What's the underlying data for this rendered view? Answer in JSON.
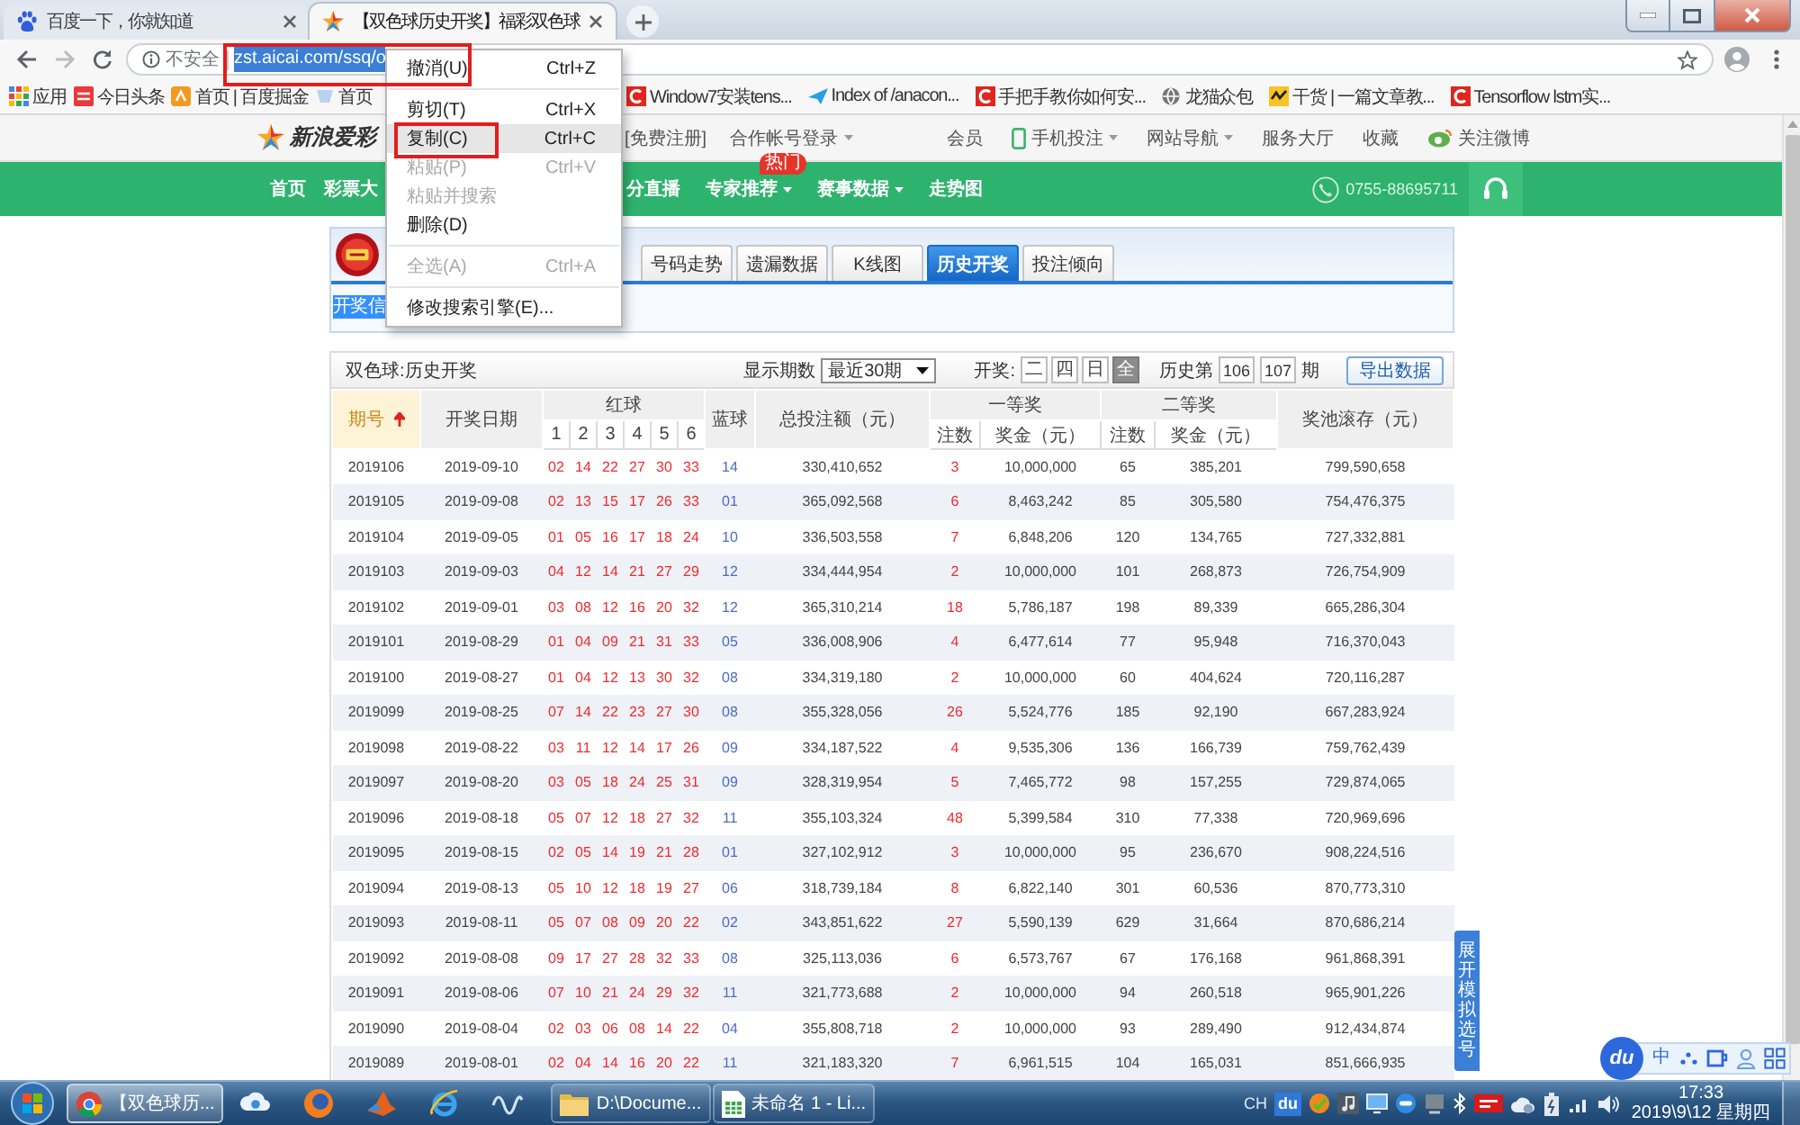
{
  "browser": {
    "tabs": [
      {
        "title": "百度一下，你就知道",
        "selected": false
      },
      {
        "title": "【双色球历史开奖】福彩双色球",
        "selected": true
      }
    ],
    "address": {
      "security": "不安全",
      "url": "zst.aicai.com/ssq/o",
      "highlighted": true
    },
    "bookmarks": [
      {
        "label": "应用"
      },
      {
        "label": "今日头条"
      },
      {
        "label": "首页 | 百度掘金"
      },
      {
        "label": "首页"
      },
      {
        "label": "Window7安装tens..."
      },
      {
        "label": "Index of /anacon..."
      },
      {
        "label": "手把手教你如何安..."
      },
      {
        "label": "龙猫众包"
      },
      {
        "label": "干货 | 一篇文章教..."
      },
      {
        "label": "Tensorflow lstm实..."
      }
    ]
  },
  "context_menu": {
    "items": [
      {
        "kind": "item",
        "label": "撤消(U)",
        "shortcut": "Ctrl+Z",
        "disabled": false,
        "selected": false
      },
      {
        "kind": "separator"
      },
      {
        "kind": "item",
        "label": "剪切(T)",
        "shortcut": "Ctrl+X",
        "disabled": false,
        "selected": false
      },
      {
        "kind": "item",
        "label": "复制(C)",
        "shortcut": "Ctrl+C",
        "disabled": false,
        "selected": true
      },
      {
        "kind": "item",
        "label": "粘贴(P)",
        "shortcut": "Ctrl+V",
        "disabled": true,
        "selected": false
      },
      {
        "kind": "item",
        "label": "粘贴并搜索",
        "disabled": true,
        "selected": false
      },
      {
        "kind": "item",
        "label": "删除(D)",
        "disabled": false,
        "selected": false
      },
      {
        "kind": "separator"
      },
      {
        "kind": "item",
        "label": "全选(A)",
        "shortcut": "Ctrl+A",
        "disabled": true,
        "selected": false
      },
      {
        "kind": "separator"
      },
      {
        "kind": "item",
        "label": "修改搜索引擎(E)...",
        "disabled": false,
        "selected": false
      }
    ]
  },
  "site_header": {
    "logo": "新浪爱彩",
    "account_links": [
      {
        "label": "[免费注册]",
        "dropdown": false
      },
      {
        "label": "合作帐号登录",
        "dropdown": true
      }
    ],
    "links": [
      {
        "label": "会员",
        "dropdown": false
      },
      {
        "label": "手机投注",
        "dropdown": true
      },
      {
        "label": "网站导航",
        "dropdown": true
      },
      {
        "label": "服务大厅",
        "dropdown": false
      },
      {
        "label": "收藏",
        "dropdown": false
      },
      {
        "label": "关注微博",
        "dropdown": false
      }
    ]
  },
  "nav": {
    "items": [
      {
        "label": "首页",
        "dropdown": false
      },
      {
        "label": "彩票大",
        "dropdown": false
      },
      {
        "label": "分直播",
        "dropdown": false
      },
      {
        "label": "专家推荐",
        "dropdown": true,
        "badge": "热门"
      },
      {
        "label": "赛事数据",
        "dropdown": true
      },
      {
        "label": "走势图",
        "dropdown": false
      }
    ],
    "hotline": "0755-88695711"
  },
  "lottery_panel": {
    "tabs": [
      {
        "label": "号码走势",
        "selected": false
      },
      {
        "label": "遗漏数据",
        "selected": false
      },
      {
        "label": "K线图",
        "selected": false
      },
      {
        "label": "历史开奖",
        "selected": true
      },
      {
        "label": "投注倾向",
        "selected": false
      }
    ],
    "info": {
      "text": "开奖信",
      "highlighted": true
    }
  },
  "results": {
    "title": "双色球:历史开奖",
    "period_label": "显示期数",
    "period_select": "最近30期",
    "draw_label": "开奖:",
    "draw_days": [
      {
        "label": "二",
        "selected": false
      },
      {
        "label": "四",
        "selected": false
      },
      {
        "label": "日",
        "selected": false
      },
      {
        "label": "全",
        "selected": true
      }
    ],
    "history_label": "历史第",
    "history_from": "106",
    "history_to": "107",
    "history_unit": "期",
    "export": "导出数据",
    "columns": [
      {
        "label": "期号",
        "sorted": true
      },
      {
        "label": "开奖日期",
        "sorted": false
      },
      {
        "label": "红球",
        "sorted": false,
        "sub": [
          "1",
          "2",
          "3",
          "4",
          "5",
          "6"
        ]
      },
      {
        "label": "蓝球",
        "sorted": false
      },
      {
        "label": "总投注额（元）",
        "sorted": false
      },
      {
        "label": "一等奖",
        "sorted": false,
        "sub": [
          "注数",
          "奖金（元）"
        ]
      },
      {
        "label": "二等奖",
        "sorted": false,
        "sub": [
          "注数",
          "奖金（元）"
        ]
      },
      {
        "label": "奖池滚存（元）",
        "sorted": false
      }
    ],
    "rows": [
      {
        "issue": "2019106",
        "date": "2019-09-10",
        "red": [
          "02",
          "14",
          "22",
          "27",
          "30",
          "33"
        ],
        "blue": "14",
        "sales": "330,410,652",
        "first_count": "3",
        "first_prize": "10,000,000",
        "second_count": "65",
        "second_prize": "385,201",
        "pool": "799,590,658"
      },
      {
        "issue": "2019105",
        "date": "2019-09-08",
        "red": [
          "02",
          "13",
          "15",
          "17",
          "26",
          "33"
        ],
        "blue": "01",
        "sales": "365,092,568",
        "first_count": "6",
        "first_prize": "8,463,242",
        "second_count": "85",
        "second_prize": "305,580",
        "pool": "754,476,375"
      },
      {
        "issue": "2019104",
        "date": "2019-09-05",
        "red": [
          "01",
          "05",
          "16",
          "17",
          "18",
          "24"
        ],
        "blue": "10",
        "sales": "336,503,558",
        "first_count": "7",
        "first_prize": "6,848,206",
        "second_count": "120",
        "second_prize": "134,765",
        "pool": "727,332,881"
      },
      {
        "issue": "2019103",
        "date": "2019-09-03",
        "red": [
          "04",
          "12",
          "14",
          "21",
          "27",
          "29"
        ],
        "blue": "12",
        "sales": "334,444,954",
        "first_count": "2",
        "first_prize": "10,000,000",
        "second_count": "101",
        "second_prize": "268,873",
        "pool": "726,754,909"
      },
      {
        "issue": "2019102",
        "date": "2019-09-01",
        "red": [
          "03",
          "08",
          "12",
          "16",
          "20",
          "32"
        ],
        "blue": "12",
        "sales": "365,310,214",
        "first_count": "18",
        "first_prize": "5,786,187",
        "second_count": "198",
        "second_prize": "89,339",
        "pool": "665,286,304"
      },
      {
        "issue": "2019101",
        "date": "2019-08-29",
        "red": [
          "01",
          "04",
          "09",
          "21",
          "31",
          "33"
        ],
        "blue": "05",
        "sales": "336,008,906",
        "first_count": "4",
        "first_prize": "6,477,614",
        "second_count": "77",
        "second_prize": "95,948",
        "pool": "716,370,043"
      },
      {
        "issue": "2019100",
        "date": "2019-08-27",
        "red": [
          "01",
          "04",
          "12",
          "13",
          "30",
          "32"
        ],
        "blue": "08",
        "sales": "334,319,180",
        "first_count": "2",
        "first_prize": "10,000,000",
        "second_count": "60",
        "second_prize": "404,624",
        "pool": "720,116,287"
      },
      {
        "issue": "2019099",
        "date": "2019-08-25",
        "red": [
          "07",
          "14",
          "22",
          "23",
          "27",
          "30"
        ],
        "blue": "08",
        "sales": "355,328,056",
        "first_count": "26",
        "first_prize": "5,524,776",
        "second_count": "185",
        "second_prize": "92,190",
        "pool": "667,283,924"
      },
      {
        "issue": "2019098",
        "date": "2019-08-22",
        "red": [
          "03",
          "11",
          "12",
          "14",
          "17",
          "26"
        ],
        "blue": "09",
        "sales": "334,187,522",
        "first_count": "4",
        "first_prize": "9,535,306",
        "second_count": "136",
        "second_prize": "166,739",
        "pool": "759,762,439"
      },
      {
        "issue": "2019097",
        "date": "2019-08-20",
        "red": [
          "03",
          "05",
          "18",
          "24",
          "25",
          "31"
        ],
        "blue": "09",
        "sales": "328,319,954",
        "first_count": "5",
        "first_prize": "7,465,772",
        "second_count": "98",
        "second_prize": "157,255",
        "pool": "729,874,065"
      },
      {
        "issue": "2019096",
        "date": "2019-08-18",
        "red": [
          "05",
          "07",
          "12",
          "18",
          "27",
          "32"
        ],
        "blue": "11",
        "sales": "355,103,324",
        "first_count": "48",
        "first_prize": "5,399,584",
        "second_count": "310",
        "second_prize": "77,338",
        "pool": "720,969,696"
      },
      {
        "issue": "2019095",
        "date": "2019-08-15",
        "red": [
          "02",
          "05",
          "14",
          "19",
          "21",
          "28"
        ],
        "blue": "01",
        "sales": "327,102,912",
        "first_count": "3",
        "first_prize": "10,000,000",
        "second_count": "95",
        "second_prize": "236,670",
        "pool": "908,224,516"
      },
      {
        "issue": "2019094",
        "date": "2019-08-13",
        "red": [
          "05",
          "10",
          "12",
          "18",
          "19",
          "27"
        ],
        "blue": "06",
        "sales": "318,739,184",
        "first_count": "8",
        "first_prize": "6,822,140",
        "second_count": "301",
        "second_prize": "60,536",
        "pool": "870,773,310"
      },
      {
        "issue": "2019093",
        "date": "2019-08-11",
        "red": [
          "05",
          "07",
          "08",
          "09",
          "20",
          "22"
        ],
        "blue": "02",
        "sales": "343,851,622",
        "first_count": "27",
        "first_prize": "5,590,139",
        "second_count": "629",
        "second_prize": "31,664",
        "pool": "870,686,214"
      },
      {
        "issue": "2019092",
        "date": "2019-08-08",
        "red": [
          "09",
          "17",
          "27",
          "28",
          "32",
          "33"
        ],
        "blue": "08",
        "sales": "325,113,036",
        "first_count": "6",
        "first_prize": "6,573,767",
        "second_count": "67",
        "second_prize": "176,168",
        "pool": "961,868,391"
      },
      {
        "issue": "2019091",
        "date": "2019-08-06",
        "red": [
          "07",
          "10",
          "21",
          "24",
          "29",
          "32"
        ],
        "blue": "11",
        "sales": "321,773,688",
        "first_count": "2",
        "first_prize": "10,000,000",
        "second_count": "94",
        "second_prize": "260,518",
        "pool": "965,901,226"
      },
      {
        "issue": "2019090",
        "date": "2019-08-04",
        "red": [
          "02",
          "03",
          "06",
          "08",
          "14",
          "22"
        ],
        "blue": "04",
        "sales": "355,808,718",
        "first_count": "2",
        "first_prize": "10,000,000",
        "second_count": "93",
        "second_prize": "289,490",
        "pool": "912,434,874"
      },
      {
        "issue": "2019089",
        "date": "2019-08-01",
        "red": [
          "02",
          "04",
          "14",
          "16",
          "20",
          "22"
        ],
        "blue": "11",
        "sales": "321,183,320",
        "first_count": "7",
        "first_prize": "6,961,515",
        "second_count": "104",
        "second_prize": "165,031",
        "pool": "851,666,935"
      }
    ]
  },
  "side_tab": "展开模拟选号",
  "ime_toolbar": {
    "logo": "du",
    "mode": "中"
  },
  "taskbar": {
    "windows": [
      {
        "title": "【双色球历...",
        "selected": true
      },
      {
        "title": "D:\\Docume...",
        "selected": false
      },
      {
        "title": "未命名 1 - Li...",
        "selected": false
      }
    ],
    "language": "CH",
    "tray_app": "du",
    "time": "17:33",
    "date": "2019\\9\\12 星期四"
  }
}
